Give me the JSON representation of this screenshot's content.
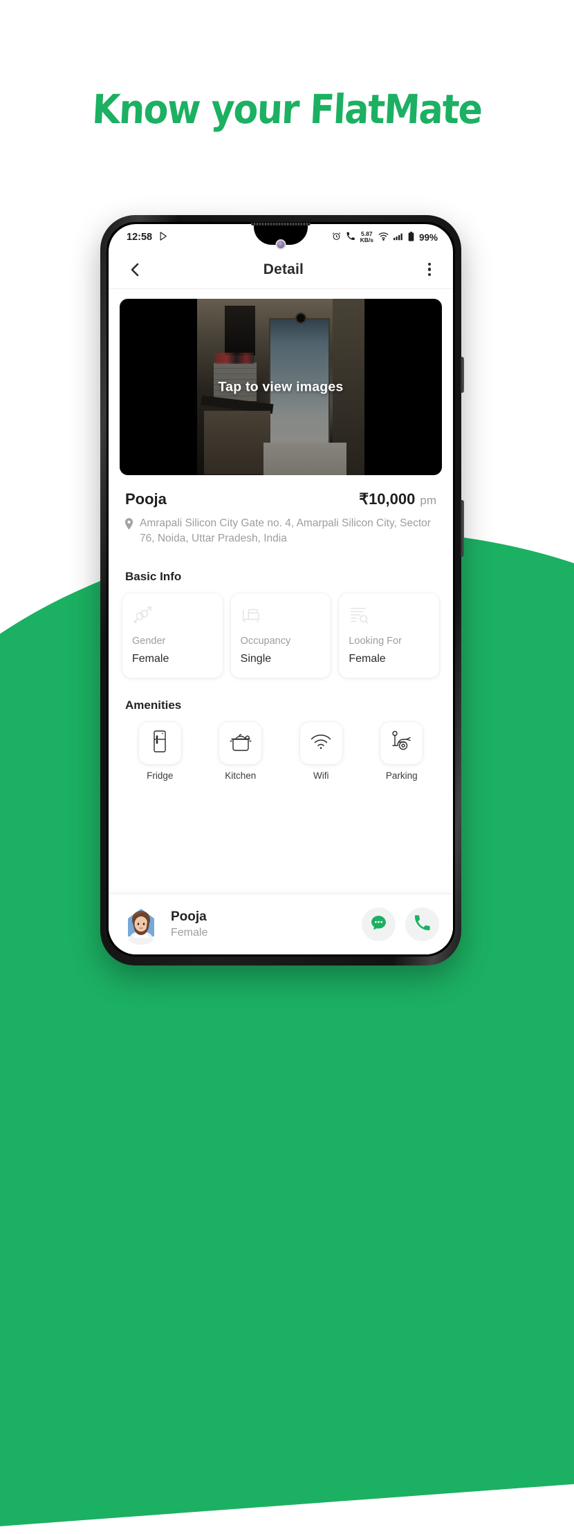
{
  "page": {
    "headline": "Know your FlatMate",
    "brand_green": "#1CB062",
    "background": "#FFFFFF"
  },
  "status_bar": {
    "time": "12:58",
    "play_icon": "play-store-icon",
    "alarm_icon": "alarm-icon",
    "call_vibrate_icon": "call-vibrate-icon",
    "network_speed": "5.87",
    "network_speed_unit": "KB/s",
    "wifi_icon": "wifi-icon",
    "signal_icon": "cellular-signal-icon",
    "battery_icon": "battery-icon",
    "battery_level": "99%"
  },
  "app_bar": {
    "back_icon": "chevron-left-icon",
    "title": "Detail",
    "menu_icon": "more-vertical-icon"
  },
  "hero": {
    "overlay_label": "Tap to view images",
    "image_alt": "kitchen-photo"
  },
  "listing": {
    "name": "Pooja",
    "price": "₹10,000",
    "price_unit": "pm",
    "location_icon": "map-pin-icon",
    "address": "Amrapali Silicon City Gate no. 4, Amarpali Silicon City, Sector 76, Noida, Uttar Pradesh, India"
  },
  "basic_info": {
    "title": "Basic Info",
    "cards": [
      {
        "icon": "gender-symbols-icon",
        "label": "Gender",
        "value": "Female"
      },
      {
        "icon": "bed-icon",
        "label": "Occupancy",
        "value": "Single"
      },
      {
        "icon": "list-search-icon",
        "label": "Looking For",
        "value": "Female"
      }
    ]
  },
  "amenities": {
    "title": "Amenities",
    "items": [
      {
        "icon": "fridge-icon",
        "label": "Fridge"
      },
      {
        "icon": "cooking-pot-icon",
        "label": "Kitchen"
      },
      {
        "icon": "wifi-icon",
        "label": "Wifi"
      },
      {
        "icon": "scooter-icon",
        "label": "Parking"
      }
    ]
  },
  "bottom_bar": {
    "avatar_icon": "user-avatar-female",
    "name": "Pooja",
    "subtitle": "Female",
    "chat_icon": "chat-bubble-icon",
    "call_icon": "phone-call-icon",
    "action_color": "#1CB062"
  }
}
